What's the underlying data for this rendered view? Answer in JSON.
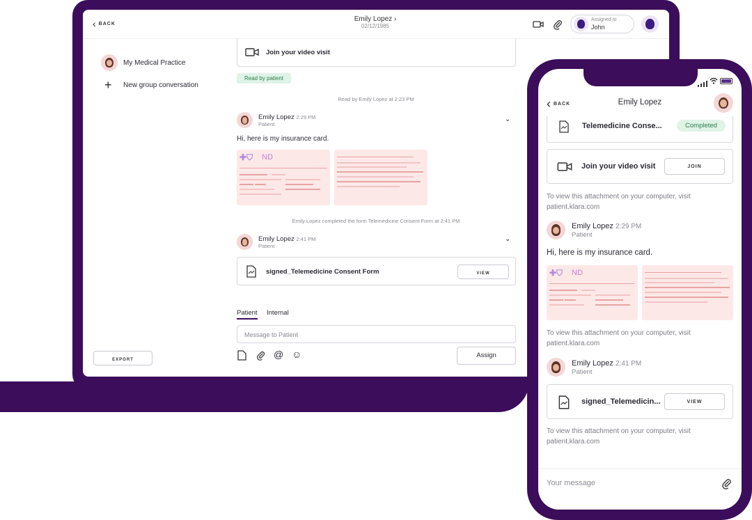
{
  "desktop": {
    "back_label": "BACK",
    "header": {
      "name": "Emily Lopez",
      "dob": "02/12/1985",
      "assigned_label": "Assigned to",
      "assigned_name": "John"
    },
    "sidebar": {
      "practice": "My Medical Practice",
      "new_group": "New group conversation",
      "export": "EXPORT"
    },
    "video_card": {
      "label": "Join your video visit"
    },
    "read_tag": "Read by patient",
    "read_info": "Read by Emily Lopez at 2:23 PM",
    "msg1": {
      "name": "Emily Lopez",
      "time": "2:29 PM",
      "role": "Patient",
      "text": "Hi, here is my insurance card.",
      "card_logo": "ND"
    },
    "completed_info": "Emily Lopez completed the form Telemedicine Consent Form at 2:41 PM",
    "msg2": {
      "name": "Emily Lopez",
      "time": "2:41 PM",
      "role": "Patient",
      "file": "signed_Telemedicine Consent Form",
      "view": "VIEW"
    },
    "tabs": [
      "Patient",
      "Internal"
    ],
    "composer": {
      "placeholder": "Message to Patient",
      "assign": "Assign"
    }
  },
  "mobile": {
    "back_label": "BACK",
    "title": "Emily Lopez",
    "form_card": {
      "label": "Telemedicine Conse...",
      "status": "Completed"
    },
    "video_card": {
      "label": "Join your video visit",
      "join": "JOIN"
    },
    "attach_note_1": "To view this attachment on your computer, visit patient.klara.com",
    "msg1": {
      "name": "Emily Lopez",
      "time": "2:29 PM",
      "role": "Patient",
      "text": "Hi, here is my insurance card.",
      "card_logo": "ND"
    },
    "attach_note_2": "To view this attachment on your computer, visit patient.klara.com",
    "msg2": {
      "name": "Emily Lopez",
      "time": "2:41 PM",
      "role": "Patient",
      "file": "signed_Telemedicin...",
      "view": "VIEW"
    },
    "attach_note_3": "To view this attachment on your computer, visit patient.klara.com",
    "composer_placeholder": "Your message"
  },
  "colors": {
    "brand_purple": "#3b0d5a",
    "completed_green": "#dff3e6",
    "insurance_pink": "#fde8e8"
  }
}
